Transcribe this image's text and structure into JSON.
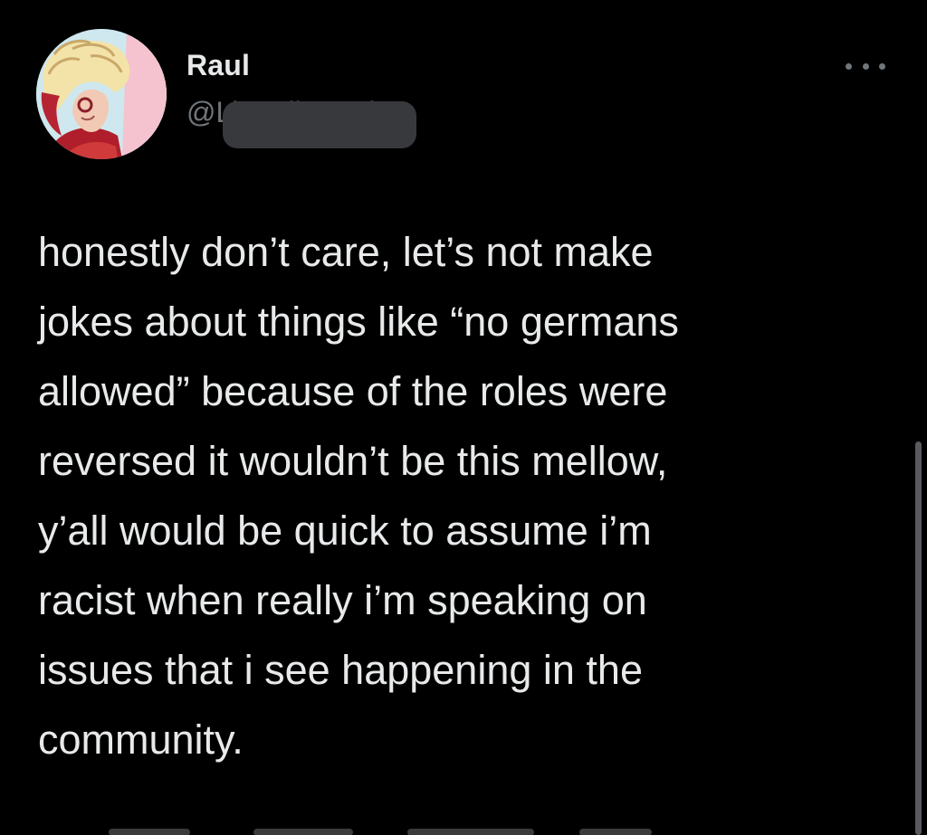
{
  "author": {
    "display_name": "Raul",
    "handle_visible": "@LiterallyRaul"
  },
  "tweet": {
    "lines": [
      "honestly don’t care, let’s not make",
      "jokes about things like “no germans",
      "allowed” because of the roles were",
      "reversed it wouldn’t be this mellow,",
      "y’all would be quick to assume i’m",
      "racist when really i’m speaking on",
      "issues that i see happening in the",
      "community."
    ]
  },
  "icons": {
    "more": "more-horizontal-icon",
    "avatar": "profile-avatar"
  },
  "colors": {
    "background": "#000000",
    "primary_text": "#e7e9ea",
    "secondary_text": "#71767b",
    "redaction": "#38393c"
  }
}
